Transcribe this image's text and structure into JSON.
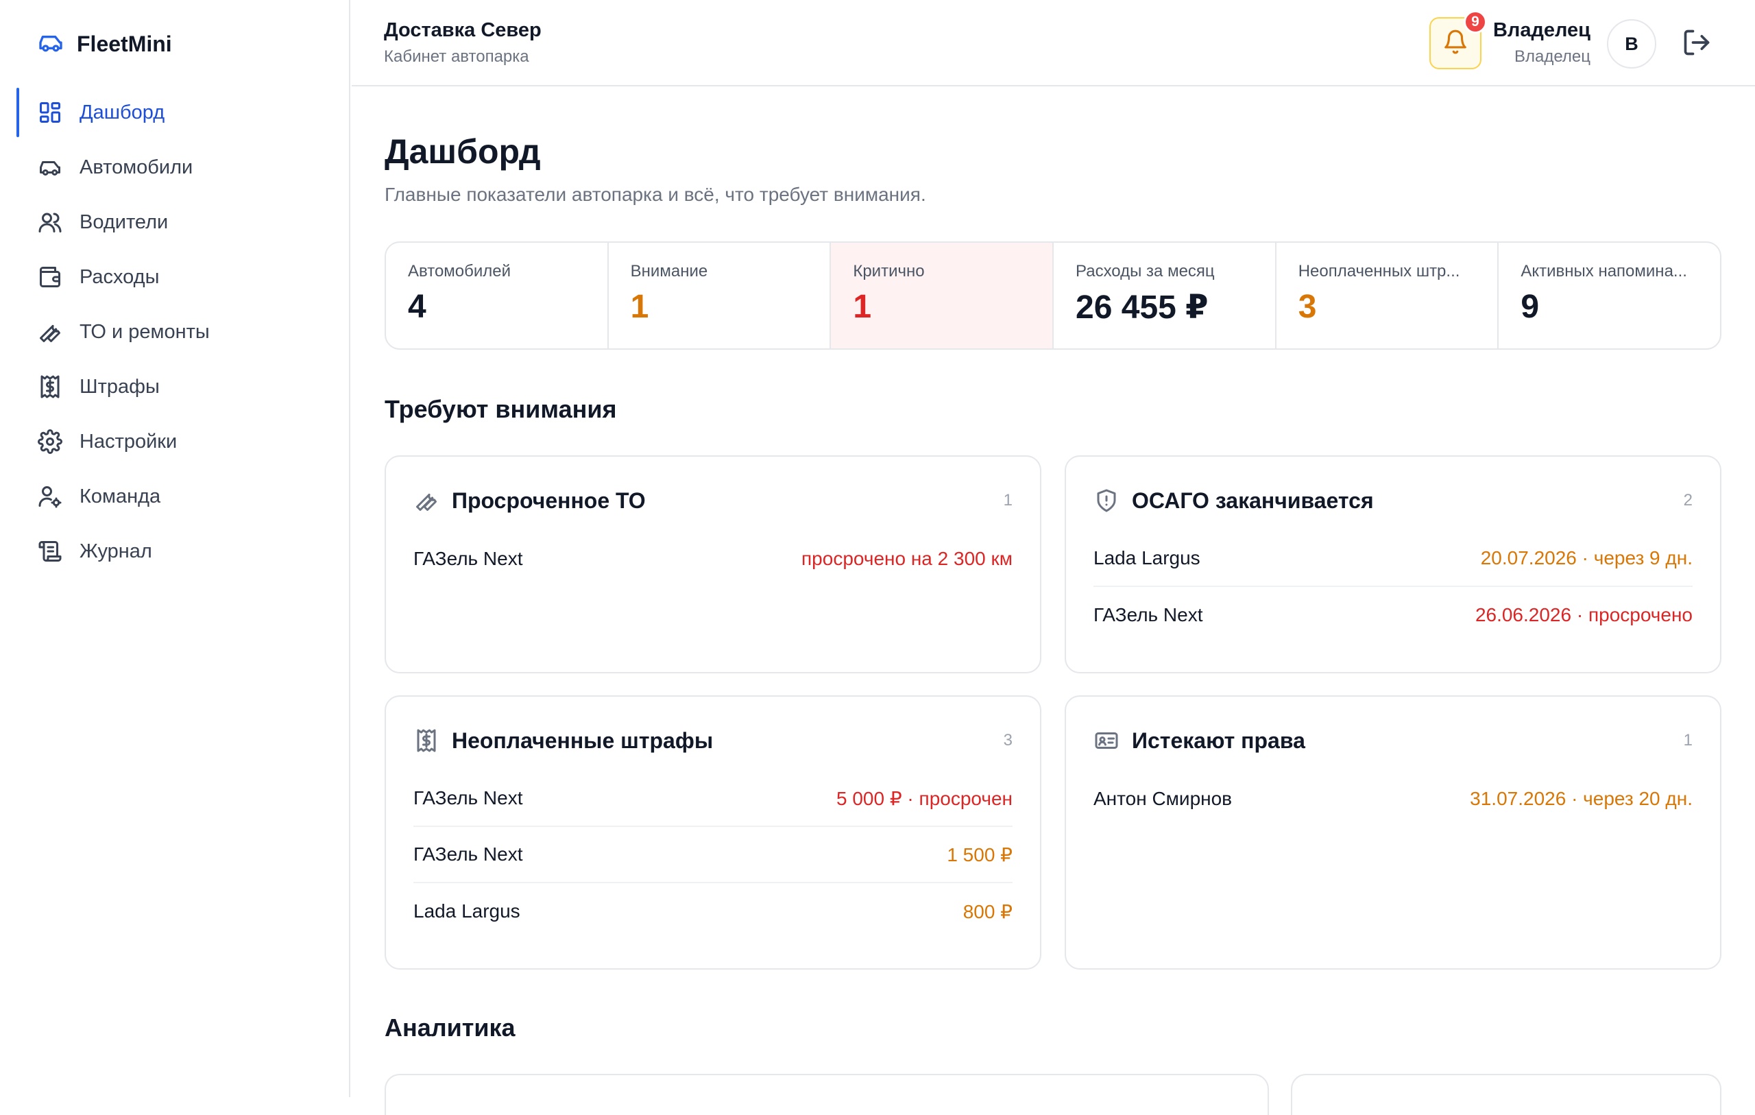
{
  "brand": {
    "name": "FleetMini"
  },
  "nav": [
    {
      "label": "Дашборд",
      "icon": "dashboard-icon",
      "active": true
    },
    {
      "label": "Автомобили",
      "icon": "car-icon"
    },
    {
      "label": "Водители",
      "icon": "users-icon"
    },
    {
      "label": "Расходы",
      "icon": "wallet-icon"
    },
    {
      "label": "ТО и ремонты",
      "icon": "wrench-icon"
    },
    {
      "label": "Штрафы",
      "icon": "receipt-icon"
    },
    {
      "label": "Настройки",
      "icon": "gear-icon"
    },
    {
      "label": "Команда",
      "icon": "user-cog-icon"
    },
    {
      "label": "Журнал",
      "icon": "scroll-icon"
    }
  ],
  "header": {
    "org_name": "Доставка Север",
    "org_subtitle": "Кабинет автопарка",
    "notifications_count": "9",
    "user_name": "Владелец",
    "user_role": "Владелец",
    "avatar_letter": "В"
  },
  "page": {
    "title": "Дашборд",
    "subtitle": "Главные показатели автопарка и всё, что требует внимания."
  },
  "stats": [
    {
      "label": "Автомобилей",
      "value": "4",
      "tone": "default"
    },
    {
      "label": "Внимание",
      "value": "1",
      "tone": "amber"
    },
    {
      "label": "Критично",
      "value": "1",
      "tone": "red"
    },
    {
      "label": "Расходы за месяц",
      "value": "26 455 ₽",
      "tone": "default"
    },
    {
      "label": "Неоплаченных штр...",
      "value": "3",
      "tone": "amber"
    },
    {
      "label": "Активных напомина...",
      "value": "9",
      "tone": "default"
    }
  ],
  "sections": {
    "attention": "Требуют внимания",
    "analytics": "Аналитика"
  },
  "cards": [
    {
      "title": "Просроченное ТО",
      "count": "1",
      "icon": "wrench-icon",
      "rows": [
        {
          "name": "ГАЗель Next",
          "value": "просрочено на 2 300 км",
          "tone": "red"
        }
      ]
    },
    {
      "title": "ОСАГО заканчивается",
      "count": "2",
      "icon": "shield-alert-icon",
      "rows": [
        {
          "name": "Lada Largus",
          "value": "20.07.2026 · через 9 дн.",
          "tone": "amber"
        },
        {
          "name": "ГАЗель Next",
          "value": "26.06.2026 · просрочено",
          "tone": "red"
        }
      ]
    },
    {
      "title": "Неоплаченные штрафы",
      "count": "3",
      "icon": "receipt-icon",
      "rows": [
        {
          "name": "ГАЗель Next",
          "value": "5 000 ₽ · просрочен",
          "tone": "red"
        },
        {
          "name": "ГАЗель Next",
          "value": "1 500 ₽",
          "tone": "amber"
        },
        {
          "name": "Lada Largus",
          "value": "800 ₽",
          "tone": "amber"
        }
      ]
    },
    {
      "title": "Истекают права",
      "count": "1",
      "icon": "id-card-icon",
      "rows": [
        {
          "name": "Антон Смирнов",
          "value": "31.07.2026 · через 20 дн.",
          "tone": "amber"
        }
      ]
    }
  ],
  "colors": {
    "accent": "#2563eb",
    "danger": "#dc2626",
    "warning": "#d97706",
    "critical_bg": "#fef2f2"
  }
}
